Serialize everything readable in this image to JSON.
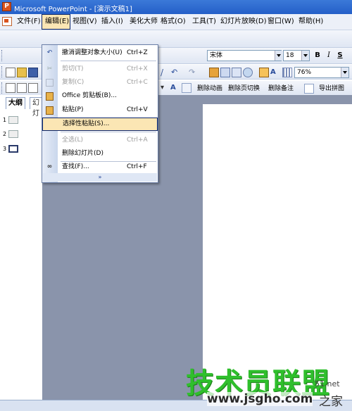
{
  "window": {
    "title": "Microsoft PowerPoint - [演示文稿1]"
  },
  "menubar": {
    "items": [
      {
        "label": "文件(F)"
      },
      {
        "label": "编辑(E)"
      },
      {
        "label": "视图(V)"
      },
      {
        "label": "插入(I)"
      },
      {
        "label": "美化大师"
      },
      {
        "label": "格式(O)"
      },
      {
        "label": "工具(T)"
      },
      {
        "label": "幻灯片放映(D)"
      },
      {
        "label": "窗口(W)"
      },
      {
        "label": "帮助(H)"
      }
    ]
  },
  "formatting": {
    "font": "宋体",
    "size": "18",
    "bold": "B",
    "italic": "I",
    "underline": "S"
  },
  "standard": {
    "zoom": "76%"
  },
  "drawing_toolbar": {
    "items": [
      {
        "label": "删除动画"
      },
      {
        "label": "删除页切换"
      },
      {
        "label": "删除备注"
      },
      {
        "label": "导出拼图"
      }
    ]
  },
  "left_panel": {
    "tabs": [
      {
        "label": "大纲"
      },
      {
        "label": "幻灯"
      }
    ],
    "slides": [
      "1",
      "2",
      "3"
    ]
  },
  "edit_menu": {
    "items": [
      {
        "label": "撤消调整对象大小(U)",
        "shortcut": "Ctrl+Z",
        "icon": "undo-icon"
      },
      {
        "label": "剪切(T)",
        "shortcut": "Ctrl+X",
        "icon": "scissors-icon"
      },
      {
        "label": "复制(C)",
        "shortcut": "Ctrl+C",
        "icon": "copy-icon"
      },
      {
        "label": "Office 剪贴板(B)...",
        "shortcut": "",
        "icon": "clipboard-icon"
      },
      {
        "label": "粘贴(P)",
        "shortcut": "Ctrl+V",
        "icon": "paste-icon"
      },
      {
        "label": "选择性粘贴(S)...",
        "shortcut": "",
        "icon": ""
      },
      {
        "label": "全选(L)",
        "shortcut": "Ctrl+A",
        "icon": ""
      },
      {
        "label": "删除幻灯片(D)",
        "shortcut": "",
        "icon": ""
      },
      {
        "label": "查找(F)...",
        "shortcut": "Ctrl+F",
        "icon": "binoculars-icon"
      }
    ],
    "expand": "»"
  },
  "watermark": {
    "brand": "技术员联盟",
    "url": "www.jsgho.com",
    "suffix": "51.net",
    "suffix2": "之家"
  }
}
